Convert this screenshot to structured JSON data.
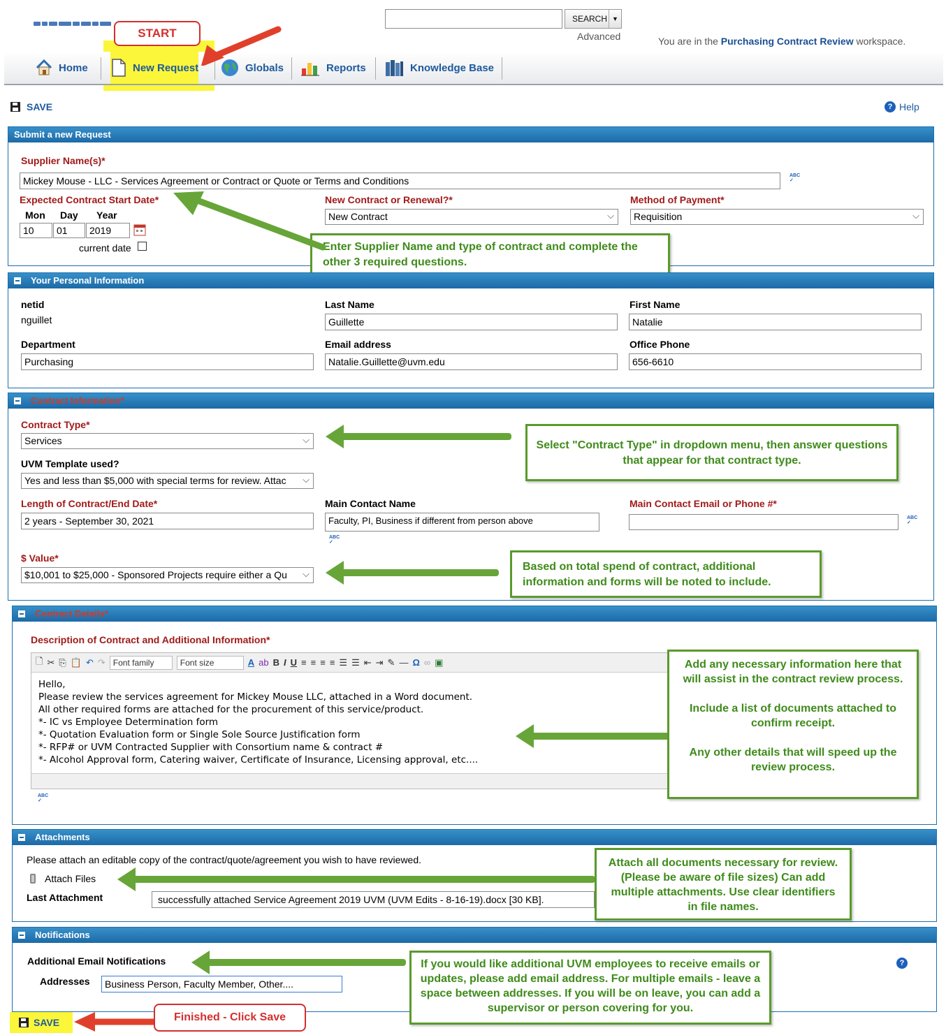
{
  "header": {
    "search_button": "SEARCH",
    "advanced_link": "Advanced",
    "workspace_prefix": "You are in the ",
    "workspace_name": "Purchasing Contract Review",
    "workspace_suffix": " workspace."
  },
  "nav": {
    "home": "Home",
    "new_request": "New Request",
    "globals": "Globals",
    "reports": "Reports",
    "knowledge_base": "Knowledge Base"
  },
  "annotations": {
    "start": "START",
    "finished": "Finished - Click Save",
    "supplier_tip": "Enter Supplier Name and type of contract and complete the other 3 required questions.",
    "contract_type_tip": "Select \"Contract Type\" in dropdown menu, then answer questions that appear for that contract type.",
    "value_tip": "Based on total spend of contract, additional information and forms will be noted to include.",
    "details_tip_1": "Add any necessary information here that will assist in the contract review process.",
    "details_tip_2": "Include a list of documents attached to confirm receipt.",
    "details_tip_3": "Any other details that will speed up the review process.",
    "attach_tip": "Attach all documents necessary for review. (Please be aware of file sizes) Can add multiple attachments. Use clear identifiers in file names.",
    "notify_tip": "If you would like additional UVM employees to receive emails or updates, please add email address. For multiple emails - leave a space between addresses. If you will be on leave, you can add a supervisor or person covering for you."
  },
  "toolbar": {
    "save": "SAVE",
    "help": "Help"
  },
  "submit": {
    "title": "Submit a new Request",
    "supplier_label": "Supplier Name(s)*",
    "supplier_value": "Mickey Mouse - LLC  - Services Agreement or Contract or Quote or Terms and Conditions",
    "start_date_label": "Expected Contract Start Date*",
    "mon_label": "Mon",
    "day_label": "Day",
    "year_label": "Year",
    "mon": "10",
    "day": "01",
    "year": "2019",
    "current_date": "current date",
    "renewal_label": "New Contract or Renewal?*",
    "renewal_value": "New Contract",
    "payment_label": "Method of Payment*",
    "payment_value": "Requisition"
  },
  "personal": {
    "title": "Your Personal Information",
    "netid_label": "netid",
    "netid": "nguillet",
    "last_label": "Last Name",
    "last": "Guillette",
    "first_label": "First Name",
    "first": "Natalie",
    "dept_label": "Department",
    "dept": "Purchasing",
    "email_label": "Email address",
    "email": "Natalie.Guillette@uvm.edu",
    "phone_label": "Office Phone",
    "phone": "656-6610"
  },
  "contract": {
    "title": "Contract Information*",
    "type_label": "Contract Type*",
    "type": "Services",
    "template_label": "UVM Template used?",
    "template": "Yes and less than $5,000 with special terms for review. Attac",
    "length_label": "Length of Contract/End Date*",
    "length": "2 years - September 30, 2021",
    "contact_label": "Main Contact Name",
    "contact": "Faculty, PI, Business if different from person above",
    "contact_email_label": "Main Contact Email or Phone #*",
    "value_label": "$ Value*",
    "value": "$10,001 to $25,000 - Sponsored Projects require either a Qu"
  },
  "details": {
    "title": "Contract Details*",
    "desc_label": "Description of Contract and Additional Information*",
    "font_family": "Font family",
    "font_size": "Font size",
    "lines": [
      "Hello,",
      "Please review the services agreement for Mickey Mouse LLC, attached in a Word document.",
      "All other required forms are attached for the procurement of this service/product.",
      "*- IC vs Employee Determination form",
      "*- Quotation Evaluation form or Single Sole Source Justification form",
      "*- RFP# or UVM Contracted Supplier with Consortium name & contract #",
      "*- Alcohol Approval form, Catering waiver, Certificate of Insurance, Licensing approval, etc...."
    ]
  },
  "attachments": {
    "title": "Attachments",
    "instructions": "Please attach an editable copy of the contract/quote/agreement you wish to have reviewed.",
    "attach_files": "Attach Files",
    "last_label": "Last Attachment",
    "last_value": "successfully attached Service Agreement 2019 UVM (UVM Edits - 8-16-19).docx [30 KB]."
  },
  "notifications": {
    "title": "Notifications",
    "additional_label": "Additional Email Notifications",
    "addresses_label": "Addresses",
    "addresses_value": "Business Person, Faculty Member, Other...."
  },
  "bottom": {
    "save": "SAVE"
  },
  "colors": {
    "accent": "#1c6aa7",
    "required": "#a11a1a",
    "callout_green": "#5a9a2c",
    "callout_red": "#d32f2f",
    "highlight": "#fbf63a"
  }
}
